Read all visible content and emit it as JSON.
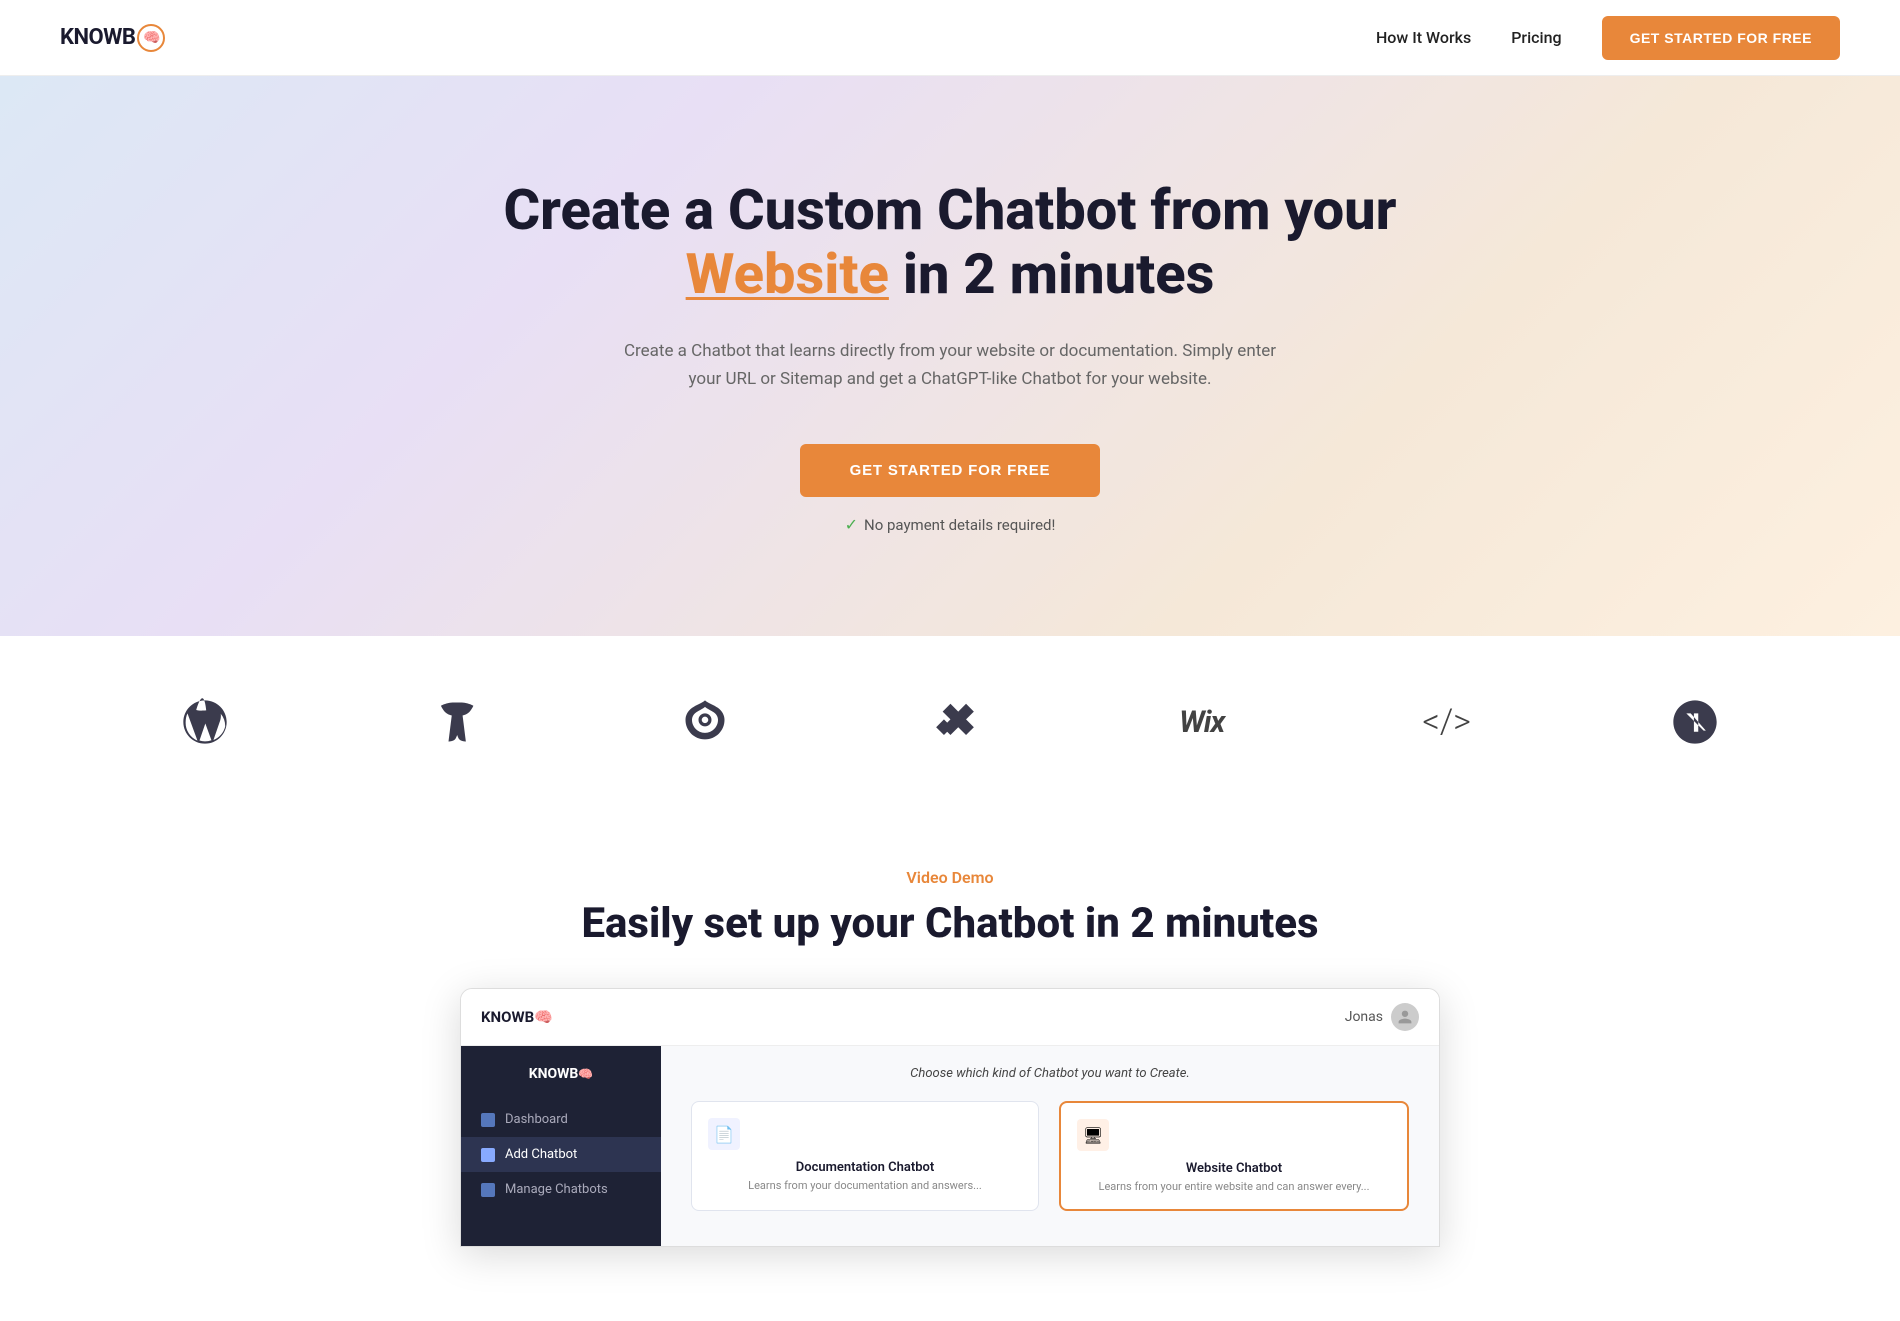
{
  "navbar": {
    "logo_text": "KNOWB",
    "logo_symbol": "🧠",
    "nav_items": [
      {
        "label": "How It Works",
        "id": "how-it-works"
      },
      {
        "label": "Pricing",
        "id": "pricing"
      }
    ],
    "cta_label": "GET STARTED FOR FREE"
  },
  "hero": {
    "title_start": "Create a Custom Chatbot from your",
    "title_highlight": "Website",
    "title_end": "in 2 minutes",
    "subtitle": "Create a Chatbot that learns directly from your website or documentation. Simply enter your URL or Sitemap and get a ChatGPT-like Chatbot for your website.",
    "cta_label": "GET STARTED FOR FREE",
    "note": "No payment details required!"
  },
  "logos": {
    "platforms": [
      {
        "name": "WordPress",
        "id": "wordpress"
      },
      {
        "name": "TYPO3",
        "id": "typo3"
      },
      {
        "name": "Drupal",
        "id": "drupal"
      },
      {
        "name": "Squarespace",
        "id": "squarespace"
      },
      {
        "name": "Wix",
        "id": "wix"
      },
      {
        "name": "Custom Code",
        "id": "code"
      },
      {
        "name": "Next.js",
        "id": "nextjs"
      }
    ]
  },
  "video_section": {
    "label": "Video Demo",
    "title": "Easily set up your Chatbot in 2 minutes"
  },
  "app_demo": {
    "topbar_logo": "KNOWB🧠",
    "user_name": "Jonas",
    "sidebar_logo": "KNOWB🧠",
    "sidebar_items": [
      {
        "label": "Dashboard",
        "active": false
      },
      {
        "label": "Add Chatbot",
        "active": true
      },
      {
        "label": "Manage Chatbots",
        "active": false
      }
    ],
    "main_prompt": "Choose which kind of Chatbot you want to Create.",
    "cards": [
      {
        "title": "Documentation Chatbot",
        "subtitle": "Learns from your documentation and answers...",
        "selected": false
      },
      {
        "title": "Website Chatbot",
        "subtitle": "Learns from your entire website and can answer every...",
        "selected": true
      }
    ]
  },
  "colors": {
    "orange": "#e8873a",
    "dark": "#1a1a2e",
    "sidebar_bg": "#1e2235"
  }
}
